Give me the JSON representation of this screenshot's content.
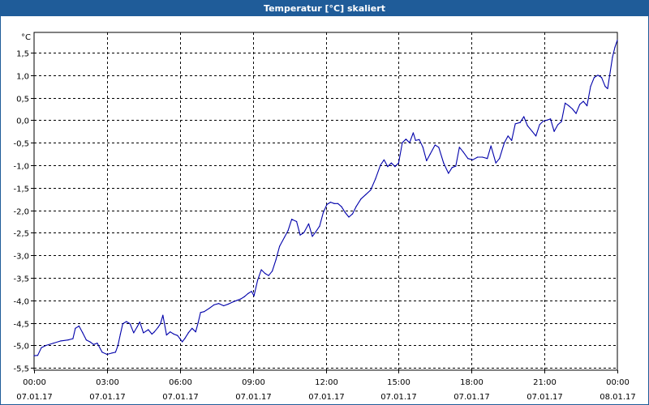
{
  "window": {
    "title": "Temperatur [°C] skaliert"
  },
  "chart_data": {
    "type": "line",
    "title": "Temperatur [°C] skaliert",
    "ylabel": "°C",
    "xlabel": "",
    "ylim": [
      -5.55,
      1.95
    ],
    "y_ticks": [
      1.5,
      1.0,
      0.5,
      0.0,
      -0.5,
      -1.0,
      -1.5,
      -2.0,
      -2.5,
      -3.0,
      -3.5,
      -4.0,
      -4.5,
      -5.0,
      -5.5
    ],
    "y_tick_labels": [
      "1,5",
      "1,0",
      "0,5",
      "0,0",
      "-0,5",
      "-1,0",
      "-1,5",
      "-2,0",
      "-2,5",
      "-3,0",
      "-3,5",
      "-4,0",
      "-4,5",
      "-5,0",
      "-5,5"
    ],
    "x_range_hours": [
      0,
      24
    ],
    "x_ticks": [
      {
        "time": "00:00",
        "date": "07.01.17",
        "hour": 0
      },
      {
        "time": "03:00",
        "date": "07.01.17",
        "hour": 3
      },
      {
        "time": "06:00",
        "date": "07.01.17",
        "hour": 6
      },
      {
        "time": "09:00",
        "date": "07.01.17",
        "hour": 9
      },
      {
        "time": "12:00",
        "date": "07.01.17",
        "hour": 12
      },
      {
        "time": "15:00",
        "date": "07.01.17",
        "hour": 15
      },
      {
        "time": "18:00",
        "date": "07.01.17",
        "hour": 18
      },
      {
        "time": "21:00",
        "date": "07.01.17",
        "hour": 21
      },
      {
        "time": "00:00",
        "date": "08.01.17",
        "hour": 24
      }
    ],
    "grid": true,
    "series": [
      {
        "color": "#0000aa",
        "points": [
          [
            0.0,
            -5.23
          ],
          [
            0.15,
            -5.22
          ],
          [
            0.3,
            -5.05
          ],
          [
            0.5,
            -5.0
          ],
          [
            0.8,
            -4.95
          ],
          [
            1.1,
            -4.9
          ],
          [
            1.4,
            -4.88
          ],
          [
            1.6,
            -4.85
          ],
          [
            1.7,
            -4.62
          ],
          [
            1.85,
            -4.57
          ],
          [
            2.0,
            -4.72
          ],
          [
            2.15,
            -4.88
          ],
          [
            2.3,
            -4.92
          ],
          [
            2.45,
            -4.98
          ],
          [
            2.6,
            -4.95
          ],
          [
            2.8,
            -5.15
          ],
          [
            3.0,
            -5.2
          ],
          [
            3.2,
            -5.17
          ],
          [
            3.35,
            -5.15
          ],
          [
            3.45,
            -5.0
          ],
          [
            3.55,
            -4.75
          ],
          [
            3.65,
            -4.52
          ],
          [
            3.8,
            -4.47
          ],
          [
            3.95,
            -4.52
          ],
          [
            4.1,
            -4.72
          ],
          [
            4.25,
            -4.58
          ],
          [
            4.35,
            -4.48
          ],
          [
            4.5,
            -4.72
          ],
          [
            4.7,
            -4.65
          ],
          [
            4.85,
            -4.75
          ],
          [
            4.95,
            -4.7
          ],
          [
            5.1,
            -4.6
          ],
          [
            5.2,
            -4.52
          ],
          [
            5.3,
            -4.33
          ],
          [
            5.45,
            -4.77
          ],
          [
            5.6,
            -4.7
          ],
          [
            5.75,
            -4.75
          ],
          [
            5.9,
            -4.78
          ],
          [
            6.0,
            -4.85
          ],
          [
            6.1,
            -4.92
          ],
          [
            6.2,
            -4.85
          ],
          [
            6.35,
            -4.72
          ],
          [
            6.5,
            -4.62
          ],
          [
            6.65,
            -4.7
          ],
          [
            6.75,
            -4.5
          ],
          [
            6.85,
            -4.27
          ],
          [
            7.0,
            -4.25
          ],
          [
            7.2,
            -4.18
          ],
          [
            7.4,
            -4.1
          ],
          [
            7.6,
            -4.07
          ],
          [
            7.8,
            -4.12
          ],
          [
            8.0,
            -4.08
          ],
          [
            8.2,
            -4.03
          ],
          [
            8.35,
            -4.0
          ],
          [
            8.5,
            -3.97
          ],
          [
            8.65,
            -3.92
          ],
          [
            8.8,
            -3.85
          ],
          [
            8.95,
            -3.8
          ],
          [
            9.05,
            -3.9
          ],
          [
            9.2,
            -3.55
          ],
          [
            9.35,
            -3.32
          ],
          [
            9.5,
            -3.4
          ],
          [
            9.65,
            -3.45
          ],
          [
            9.8,
            -3.35
          ],
          [
            9.95,
            -3.1
          ],
          [
            10.1,
            -2.8
          ],
          [
            10.3,
            -2.6
          ],
          [
            10.45,
            -2.45
          ],
          [
            10.6,
            -2.2
          ],
          [
            10.8,
            -2.25
          ],
          [
            10.95,
            -2.55
          ],
          [
            11.1,
            -2.5
          ],
          [
            11.3,
            -2.3
          ],
          [
            11.45,
            -2.58
          ],
          [
            11.6,
            -2.47
          ],
          [
            11.75,
            -2.35
          ],
          [
            11.9,
            -2.05
          ],
          [
            12.05,
            -1.87
          ],
          [
            12.2,
            -1.82
          ],
          [
            12.35,
            -1.85
          ],
          [
            12.5,
            -1.85
          ],
          [
            12.65,
            -1.92
          ],
          [
            12.8,
            -2.05
          ],
          [
            12.95,
            -2.15
          ],
          [
            13.1,
            -2.08
          ],
          [
            13.25,
            -1.92
          ],
          [
            13.45,
            -1.75
          ],
          [
            13.65,
            -1.65
          ],
          [
            13.85,
            -1.55
          ],
          [
            14.05,
            -1.3
          ],
          [
            14.25,
            -1.0
          ],
          [
            14.4,
            -0.88
          ],
          [
            14.55,
            -1.03
          ],
          [
            14.7,
            -0.95
          ],
          [
            14.85,
            -1.03
          ],
          [
            15.0,
            -0.95
          ],
          [
            15.15,
            -0.5
          ],
          [
            15.3,
            -0.42
          ],
          [
            15.45,
            -0.5
          ],
          [
            15.6,
            -0.28
          ],
          [
            15.7,
            -0.45
          ],
          [
            15.85,
            -0.43
          ],
          [
            16.0,
            -0.6
          ],
          [
            16.15,
            -0.9
          ],
          [
            16.3,
            -0.75
          ],
          [
            16.5,
            -0.55
          ],
          [
            16.65,
            -0.6
          ],
          [
            16.85,
            -0.95
          ],
          [
            17.05,
            -1.18
          ],
          [
            17.2,
            -1.05
          ],
          [
            17.35,
            -1.02
          ],
          [
            17.5,
            -0.6
          ],
          [
            17.65,
            -0.7
          ],
          [
            17.85,
            -0.85
          ],
          [
            18.05,
            -0.88
          ],
          [
            18.25,
            -0.82
          ],
          [
            18.45,
            -0.82
          ],
          [
            18.65,
            -0.85
          ],
          [
            18.8,
            -0.57
          ],
          [
            19.0,
            -0.95
          ],
          [
            19.15,
            -0.85
          ],
          [
            19.35,
            -0.5
          ],
          [
            19.5,
            -0.35
          ],
          [
            19.65,
            -0.45
          ],
          [
            19.8,
            -0.08
          ],
          [
            20.0,
            -0.05
          ],
          [
            20.15,
            0.08
          ],
          [
            20.3,
            -0.12
          ],
          [
            20.5,
            -0.25
          ],
          [
            20.65,
            -0.35
          ],
          [
            20.8,
            -0.1
          ],
          [
            20.95,
            -0.02
          ],
          [
            21.1,
            0.0
          ],
          [
            21.25,
            0.03
          ],
          [
            21.4,
            -0.25
          ],
          [
            21.55,
            -0.1
          ],
          [
            21.7,
            -0.03
          ],
          [
            21.85,
            0.38
          ],
          [
            22.0,
            0.32
          ],
          [
            22.15,
            0.25
          ],
          [
            22.3,
            0.15
          ],
          [
            22.45,
            0.35
          ],
          [
            22.6,
            0.42
          ],
          [
            22.75,
            0.32
          ],
          [
            22.9,
            0.75
          ],
          [
            23.05,
            0.95
          ],
          [
            23.2,
            1.0
          ],
          [
            23.35,
            0.95
          ],
          [
            23.5,
            0.75
          ],
          [
            23.6,
            0.7
          ],
          [
            23.7,
            1.05
          ],
          [
            23.8,
            1.4
          ],
          [
            23.9,
            1.62
          ],
          [
            24.0,
            1.78
          ]
        ]
      }
    ]
  }
}
